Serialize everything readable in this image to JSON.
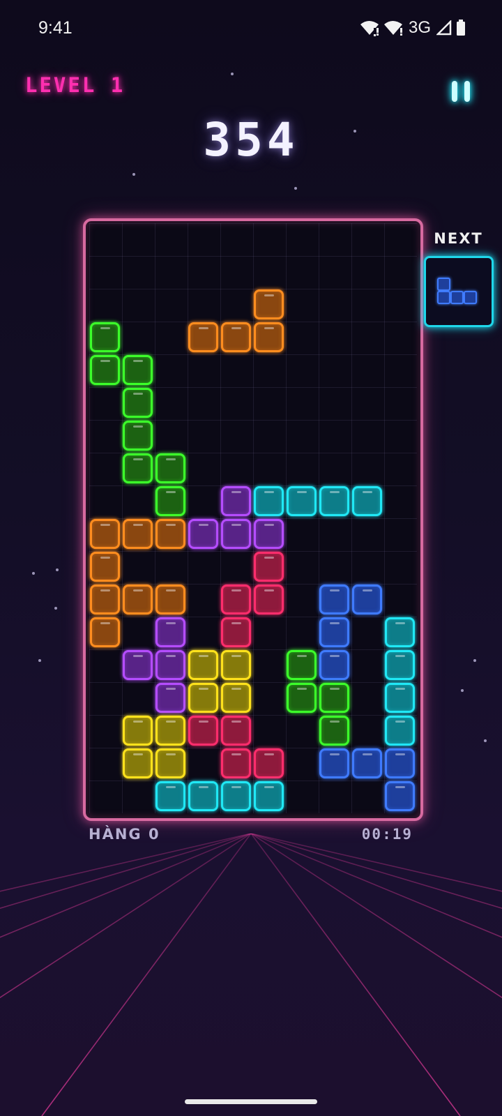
{
  "status_bar": {
    "time": "9:41",
    "network": "3G",
    "icons": [
      "wifi-alert-icon",
      "wifi-alert-icon",
      "cell-signal-icon",
      "battery-icon"
    ]
  },
  "hud": {
    "level_label": "LEVEL 1",
    "score": "354",
    "pause_icon": "pause-icon"
  },
  "next_panel": {
    "label": "NEXT",
    "piece": {
      "color": "blue",
      "cells": [
        [
          0,
          0
        ],
        [
          0,
          1
        ],
        [
          1,
          1
        ],
        [
          2,
          1
        ]
      ]
    }
  },
  "footer": {
    "lines_label": "HÀNG 0",
    "timer": "00:19"
  },
  "colors": {
    "green": {
      "border": "#3cff2a",
      "fill": "#1c6212"
    },
    "orange": {
      "border": "#ff8d1f",
      "fill": "#8a4710"
    },
    "purple": {
      "border": "#b54dff",
      "fill": "#582387"
    },
    "cyan": {
      "border": "#20e8f5",
      "fill": "#0d7d89"
    },
    "red": {
      "border": "#ff2d6c",
      "fill": "#8e1a3c"
    },
    "blue": {
      "border": "#3f7bff",
      "fill": "#1e3f9c"
    },
    "yellow": {
      "border": "#ffe21c",
      "fill": "#857a0b"
    }
  },
  "board": {
    "columns": 10,
    "rows": 18,
    "cells": [
      {
        "col": 5,
        "row": 2,
        "color": "orange"
      },
      {
        "col": 3,
        "row": 3,
        "color": "orange"
      },
      {
        "col": 4,
        "row": 3,
        "color": "orange"
      },
      {
        "col": 5,
        "row": 3,
        "color": "orange"
      },
      {
        "col": 0,
        "row": 3,
        "color": "green"
      },
      {
        "col": 0,
        "row": 4,
        "color": "green"
      },
      {
        "col": 1,
        "row": 4,
        "color": "green"
      },
      {
        "col": 1,
        "row": 5,
        "color": "green"
      },
      {
        "col": 1,
        "row": 6,
        "color": "green"
      },
      {
        "col": 1,
        "row": 7,
        "color": "green"
      },
      {
        "col": 2,
        "row": 7,
        "color": "green"
      },
      {
        "col": 2,
        "row": 8,
        "color": "green"
      },
      {
        "col": 4,
        "row": 8,
        "color": "purple"
      },
      {
        "col": 5,
        "row": 8,
        "color": "cyan"
      },
      {
        "col": 6,
        "row": 8,
        "color": "cyan"
      },
      {
        "col": 7,
        "row": 8,
        "color": "cyan"
      },
      {
        "col": 8,
        "row": 8,
        "color": "cyan"
      },
      {
        "col": 0,
        "row": 9,
        "color": "orange"
      },
      {
        "col": 1,
        "row": 9,
        "color": "orange"
      },
      {
        "col": 2,
        "row": 9,
        "color": "orange"
      },
      {
        "col": 3,
        "row": 9,
        "color": "purple"
      },
      {
        "col": 4,
        "row": 9,
        "color": "purple"
      },
      {
        "col": 5,
        "row": 9,
        "color": "purple"
      },
      {
        "col": 0,
        "row": 10,
        "color": "orange"
      },
      {
        "col": 5,
        "row": 10,
        "color": "red"
      },
      {
        "col": 0,
        "row": 11,
        "color": "orange"
      },
      {
        "col": 1,
        "row": 11,
        "color": "orange"
      },
      {
        "col": 2,
        "row": 11,
        "color": "orange"
      },
      {
        "col": 4,
        "row": 11,
        "color": "red"
      },
      {
        "col": 5,
        "row": 11,
        "color": "red"
      },
      {
        "col": 7,
        "row": 11,
        "color": "blue"
      },
      {
        "col": 8,
        "row": 11,
        "color": "blue"
      },
      {
        "col": 0,
        "row": 12,
        "color": "orange"
      },
      {
        "col": 2,
        "row": 12,
        "color": "purple"
      },
      {
        "col": 4,
        "row": 12,
        "color": "red"
      },
      {
        "col": 7,
        "row": 12,
        "color": "blue"
      },
      {
        "col": 9,
        "row": 12,
        "color": "cyan"
      },
      {
        "col": 1,
        "row": 13,
        "color": "purple"
      },
      {
        "col": 2,
        "row": 13,
        "color": "purple"
      },
      {
        "col": 3,
        "row": 13,
        "color": "yellow"
      },
      {
        "col": 4,
        "row": 13,
        "color": "yellow"
      },
      {
        "col": 6,
        "row": 13,
        "color": "green"
      },
      {
        "col": 7,
        "row": 13,
        "color": "blue"
      },
      {
        "col": 9,
        "row": 13,
        "color": "cyan"
      },
      {
        "col": 2,
        "row": 14,
        "color": "purple"
      },
      {
        "col": 3,
        "row": 14,
        "color": "yellow"
      },
      {
        "col": 4,
        "row": 14,
        "color": "yellow"
      },
      {
        "col": 6,
        "row": 14,
        "color": "green"
      },
      {
        "col": 7,
        "row": 14,
        "color": "green"
      },
      {
        "col": 9,
        "row": 14,
        "color": "cyan"
      },
      {
        "col": 1,
        "row": 15,
        "color": "yellow"
      },
      {
        "col": 2,
        "row": 15,
        "color": "yellow"
      },
      {
        "col": 3,
        "row": 15,
        "color": "red"
      },
      {
        "col": 4,
        "row": 15,
        "color": "red"
      },
      {
        "col": 7,
        "row": 15,
        "color": "green"
      },
      {
        "col": 9,
        "row": 15,
        "color": "cyan"
      },
      {
        "col": 1,
        "row": 16,
        "color": "yellow"
      },
      {
        "col": 2,
        "row": 16,
        "color": "yellow"
      },
      {
        "col": 4,
        "row": 16,
        "color": "red"
      },
      {
        "col": 5,
        "row": 16,
        "color": "red"
      },
      {
        "col": 7,
        "row": 16,
        "color": "blue"
      },
      {
        "col": 8,
        "row": 16,
        "color": "blue"
      },
      {
        "col": 9,
        "row": 16,
        "color": "blue"
      },
      {
        "col": 2,
        "row": 17,
        "color": "cyan"
      },
      {
        "col": 3,
        "row": 17,
        "color": "cyan"
      },
      {
        "col": 4,
        "row": 17,
        "color": "cyan"
      },
      {
        "col": 5,
        "row": 17,
        "color": "cyan"
      },
      {
        "col": 9,
        "row": 17,
        "color": "blue"
      }
    ]
  }
}
